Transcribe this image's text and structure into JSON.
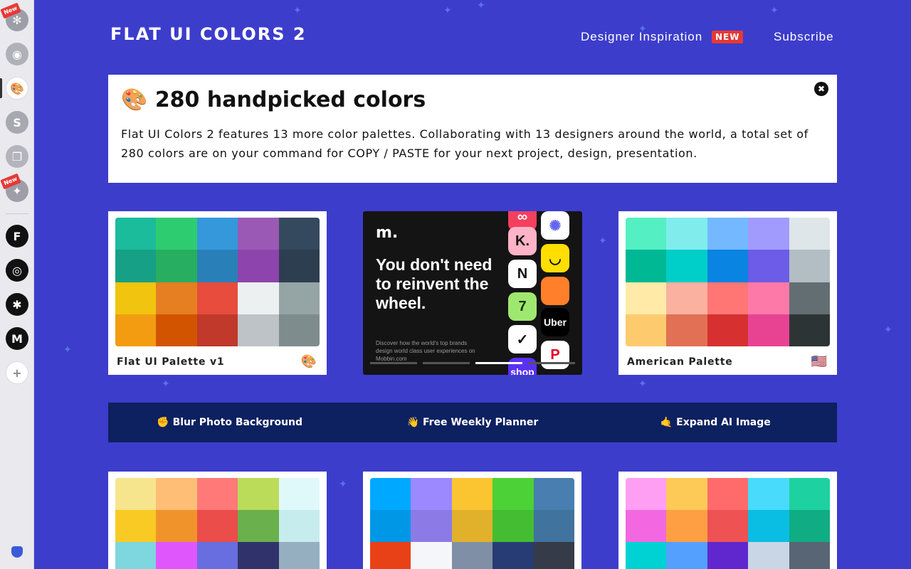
{
  "dock": {
    "items": [
      {
        "name": "dock-app-flower",
        "glyph": "✻",
        "bg": "#9e9ea8",
        "badge": "New"
      },
      {
        "name": "dock-app-shield",
        "glyph": "◉",
        "bg": "#b0b0b8",
        "badge": ""
      },
      {
        "name": "dock-app-palette",
        "glyph": "🎨",
        "bg": "#ffffff",
        "badge": ""
      },
      {
        "name": "dock-app-s",
        "glyph": "S",
        "bg": "#a8a8b0",
        "badge": ""
      },
      {
        "name": "dock-app-pages",
        "glyph": "❐",
        "bg": "#b4b4bc",
        "badge": ""
      },
      {
        "name": "dock-app-sparkle",
        "glyph": "✦",
        "bg": "#9e9ea8",
        "badge": "New"
      },
      {
        "name": "dock-app-framer",
        "glyph": "F",
        "bg": "#111111",
        "badge": ""
      },
      {
        "name": "dock-app-creative-cloud",
        "glyph": "◎",
        "bg": "#111111",
        "badge": ""
      },
      {
        "name": "dock-app-bug",
        "glyph": "✱",
        "bg": "#111111",
        "badge": ""
      },
      {
        "name": "dock-app-mobbin",
        "glyph": "M",
        "bg": "#111111",
        "badge": ""
      },
      {
        "name": "dock-app-add",
        "glyph": "+",
        "bg": "#ffffff",
        "badge": ""
      }
    ],
    "bottom_icon": "shield-icon"
  },
  "header": {
    "title": "FLAT UI COLORS 2",
    "designer_inspiration": "Designer Inspiration",
    "new_badge": "NEW",
    "subscribe": "Subscribe"
  },
  "intro": {
    "emoji": "🎨",
    "title": "280 handpicked colors",
    "text": "Flat UI Colors 2 features 13 more color palettes. Collaborating with 13 designers around the world, a total set of 280 colors are on your command for COPY / PASTE for your next project, design, presentation.",
    "close": "✖"
  },
  "palettes": [
    {
      "label": "Flat UI Palette v1",
      "emoji": "🎨",
      "colors": [
        "#1abc9c",
        "#2ecc71",
        "#3498db",
        "#9b59b6",
        "#34495e",
        "#16a085",
        "#27ae60",
        "#2980b9",
        "#8e44ad",
        "#2c3e50",
        "#f1c40f",
        "#e67e22",
        "#e74c3c",
        "#ecf0f1",
        "#95a5a6",
        "#f39c12",
        "#d35400",
        "#c0392b",
        "#bdc3c7",
        "#7f8c8d"
      ]
    },
    {
      "label": "American Palette",
      "emoji": "🇺🇸",
      "colors": [
        "#55efc4",
        "#81ecec",
        "#74b9ff",
        "#a29bfe",
        "#dfe6e9",
        "#00b894",
        "#00cec9",
        "#0984e3",
        "#6c5ce7",
        "#b2bec3",
        "#ffeaa7",
        "#fab1a0",
        "#ff7675",
        "#fd79a8",
        "#636e72",
        "#fdcb6e",
        "#e17055",
        "#d63031",
        "#e84393",
        "#2d3436"
      ]
    },
    {
      "label": "",
      "emoji": "",
      "colors": [
        "#f6e58d",
        "#ffbe76",
        "#ff7979",
        "#badc58",
        "#dff9fb",
        "#f9ca24",
        "#f0932b",
        "#eb4d4b",
        "#6ab04c",
        "#c7ecee",
        "#7ed6df",
        "#e056fd",
        "#686de0",
        "#30336b",
        "#95afc0"
      ]
    },
    {
      "label": "",
      "emoji": "",
      "colors": [
        "#00a8ff",
        "#9c88ff",
        "#fbc531",
        "#4cd137",
        "#487eb0",
        "#0097e6",
        "#8c7ae6",
        "#e1b12c",
        "#44bd32",
        "#40739e",
        "#e84118",
        "#f5f6fa",
        "#7f8fa6",
        "#273c75",
        "#353b48"
      ]
    },
    {
      "label": "",
      "emoji": "",
      "colors": [
        "#ff9ff3",
        "#feca57",
        "#ff6b6b",
        "#48dbfb",
        "#1dd1a1",
        "#f368e0",
        "#ff9f43",
        "#ee5253",
        "#0abde3",
        "#10ac84",
        "#00d2d3",
        "#54a0ff",
        "#5f27cd",
        "#c8d6e5",
        "#576574"
      ]
    }
  ],
  "ad": {
    "logo": "m.",
    "headline": "You don't need to reinvent the wheel.",
    "sub": "Discover how the world's top brands design world class user experiences on Mobbin.com",
    "apps": [
      {
        "glyph": "∞",
        "bg": "#f43f5e",
        "fg": "#fff"
      },
      {
        "glyph": "✺",
        "bg": "#ffffff",
        "fg": "#6366f1"
      },
      {
        "glyph": "K.",
        "bg": "#ffb3c7",
        "fg": "#111"
      },
      {
        "glyph": "◡",
        "bg": "#ffde00",
        "fg": "#111"
      },
      {
        "glyph": "N",
        "bg": "#ffffff",
        "fg": "#111"
      },
      {
        "glyph": "",
        "bg": "#ff7f2a",
        "fg": "#fff"
      },
      {
        "glyph": "7",
        "bg": "#9fe870",
        "fg": "#163300"
      },
      {
        "glyph": "Uber",
        "bg": "#000000",
        "fg": "#fff"
      },
      {
        "glyph": "✓",
        "bg": "#ffffff",
        "fg": "#111"
      },
      {
        "glyph": "P",
        "bg": "#ffffff",
        "fg": "#e60023"
      },
      {
        "glyph": "shop",
        "bg": "#5a31f4",
        "fg": "#fff"
      }
    ]
  },
  "promo": [
    {
      "label": "✊ Blur Photo Background"
    },
    {
      "label": "👋 Free Weekly Planner"
    },
    {
      "label": "🤙 Expand AI Image"
    }
  ]
}
